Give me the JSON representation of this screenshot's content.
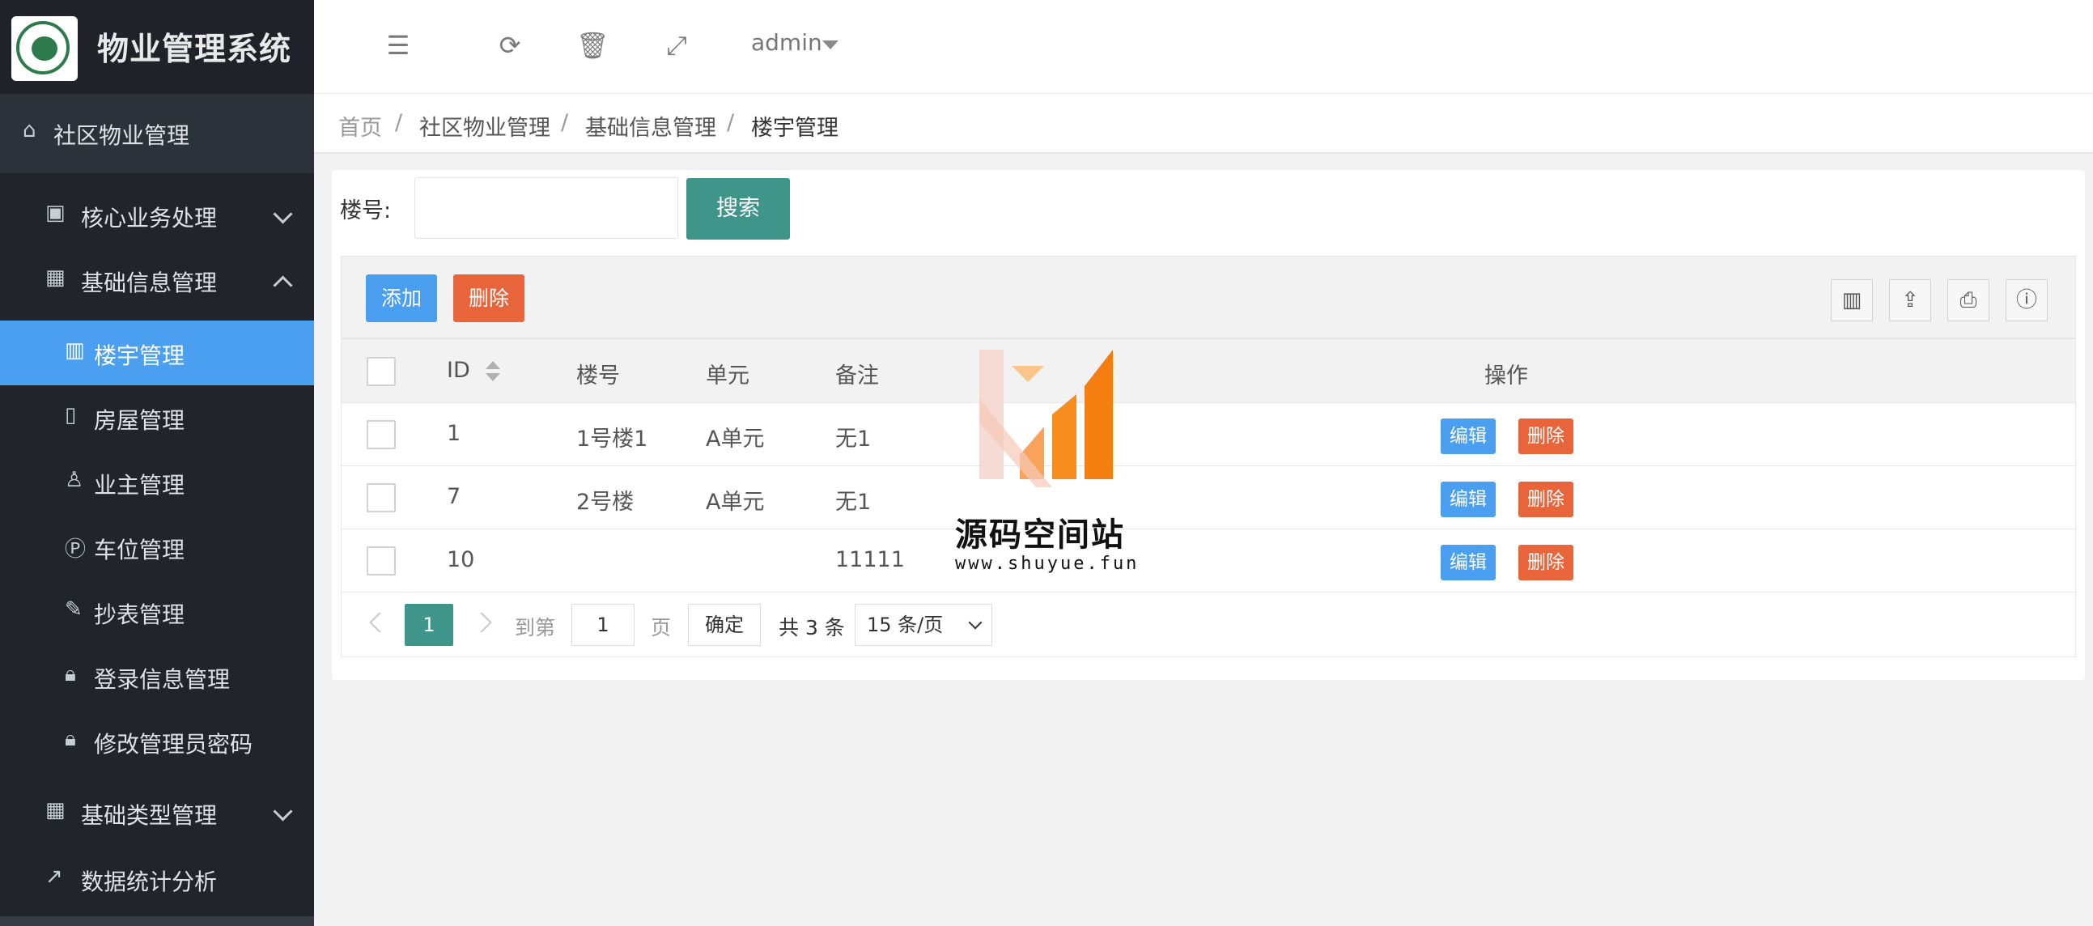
{
  "app": {
    "title": "物业管理系统"
  },
  "sidebar": {
    "section": {
      "label": "社区物业管理"
    },
    "groups": [
      {
        "label": "核心业务处理"
      },
      {
        "label": "基础信息管理"
      }
    ],
    "items": [
      {
        "label": "楼宇管理",
        "active": true
      },
      {
        "label": "房屋管理"
      },
      {
        "label": "业主管理"
      },
      {
        "label": "车位管理"
      },
      {
        "label": "抄表管理"
      },
      {
        "label": "登录信息管理"
      },
      {
        "label": "修改管理员密码"
      }
    ],
    "more_groups": [
      {
        "label": "基础类型管理"
      },
      {
        "label": "数据统计分析"
      }
    ]
  },
  "header": {
    "user": "admin"
  },
  "breadcrumb": [
    "首页",
    "社区物业管理",
    "基础信息管理",
    "楼宇管理"
  ],
  "search": {
    "label": "楼号:",
    "value": "",
    "button": "搜索"
  },
  "toolbar": {
    "add": "添加",
    "delete": "删除"
  },
  "table": {
    "columns": [
      "ID",
      "楼号",
      "单元",
      "备注",
      "操作"
    ],
    "rows": [
      {
        "id": "1",
        "building": "1号楼1",
        "unit": "A单元",
        "note": "无1",
        "edit": "编辑",
        "delete": "删除"
      },
      {
        "id": "7",
        "building": "2号楼",
        "unit": "A单元",
        "note": "无1",
        "edit": "编辑",
        "delete": "删除"
      },
      {
        "id": "10",
        "building": "",
        "unit": "",
        "note": "11111",
        "edit": "编辑",
        "delete": "删除"
      }
    ]
  },
  "pager": {
    "current": "1",
    "goto_label": "到第",
    "goto_value": "1",
    "page_unit": "页",
    "confirm": "确定",
    "total": "共 3 条",
    "page_size": "15 条/页"
  },
  "watermark": {
    "title": "源码空间站",
    "url": "www.shuyue.fun"
  },
  "colors": {
    "primary": "#3f958a",
    "blue": "#4b9ff0",
    "danger": "#e8643a",
    "sidebar": "#21252b"
  }
}
